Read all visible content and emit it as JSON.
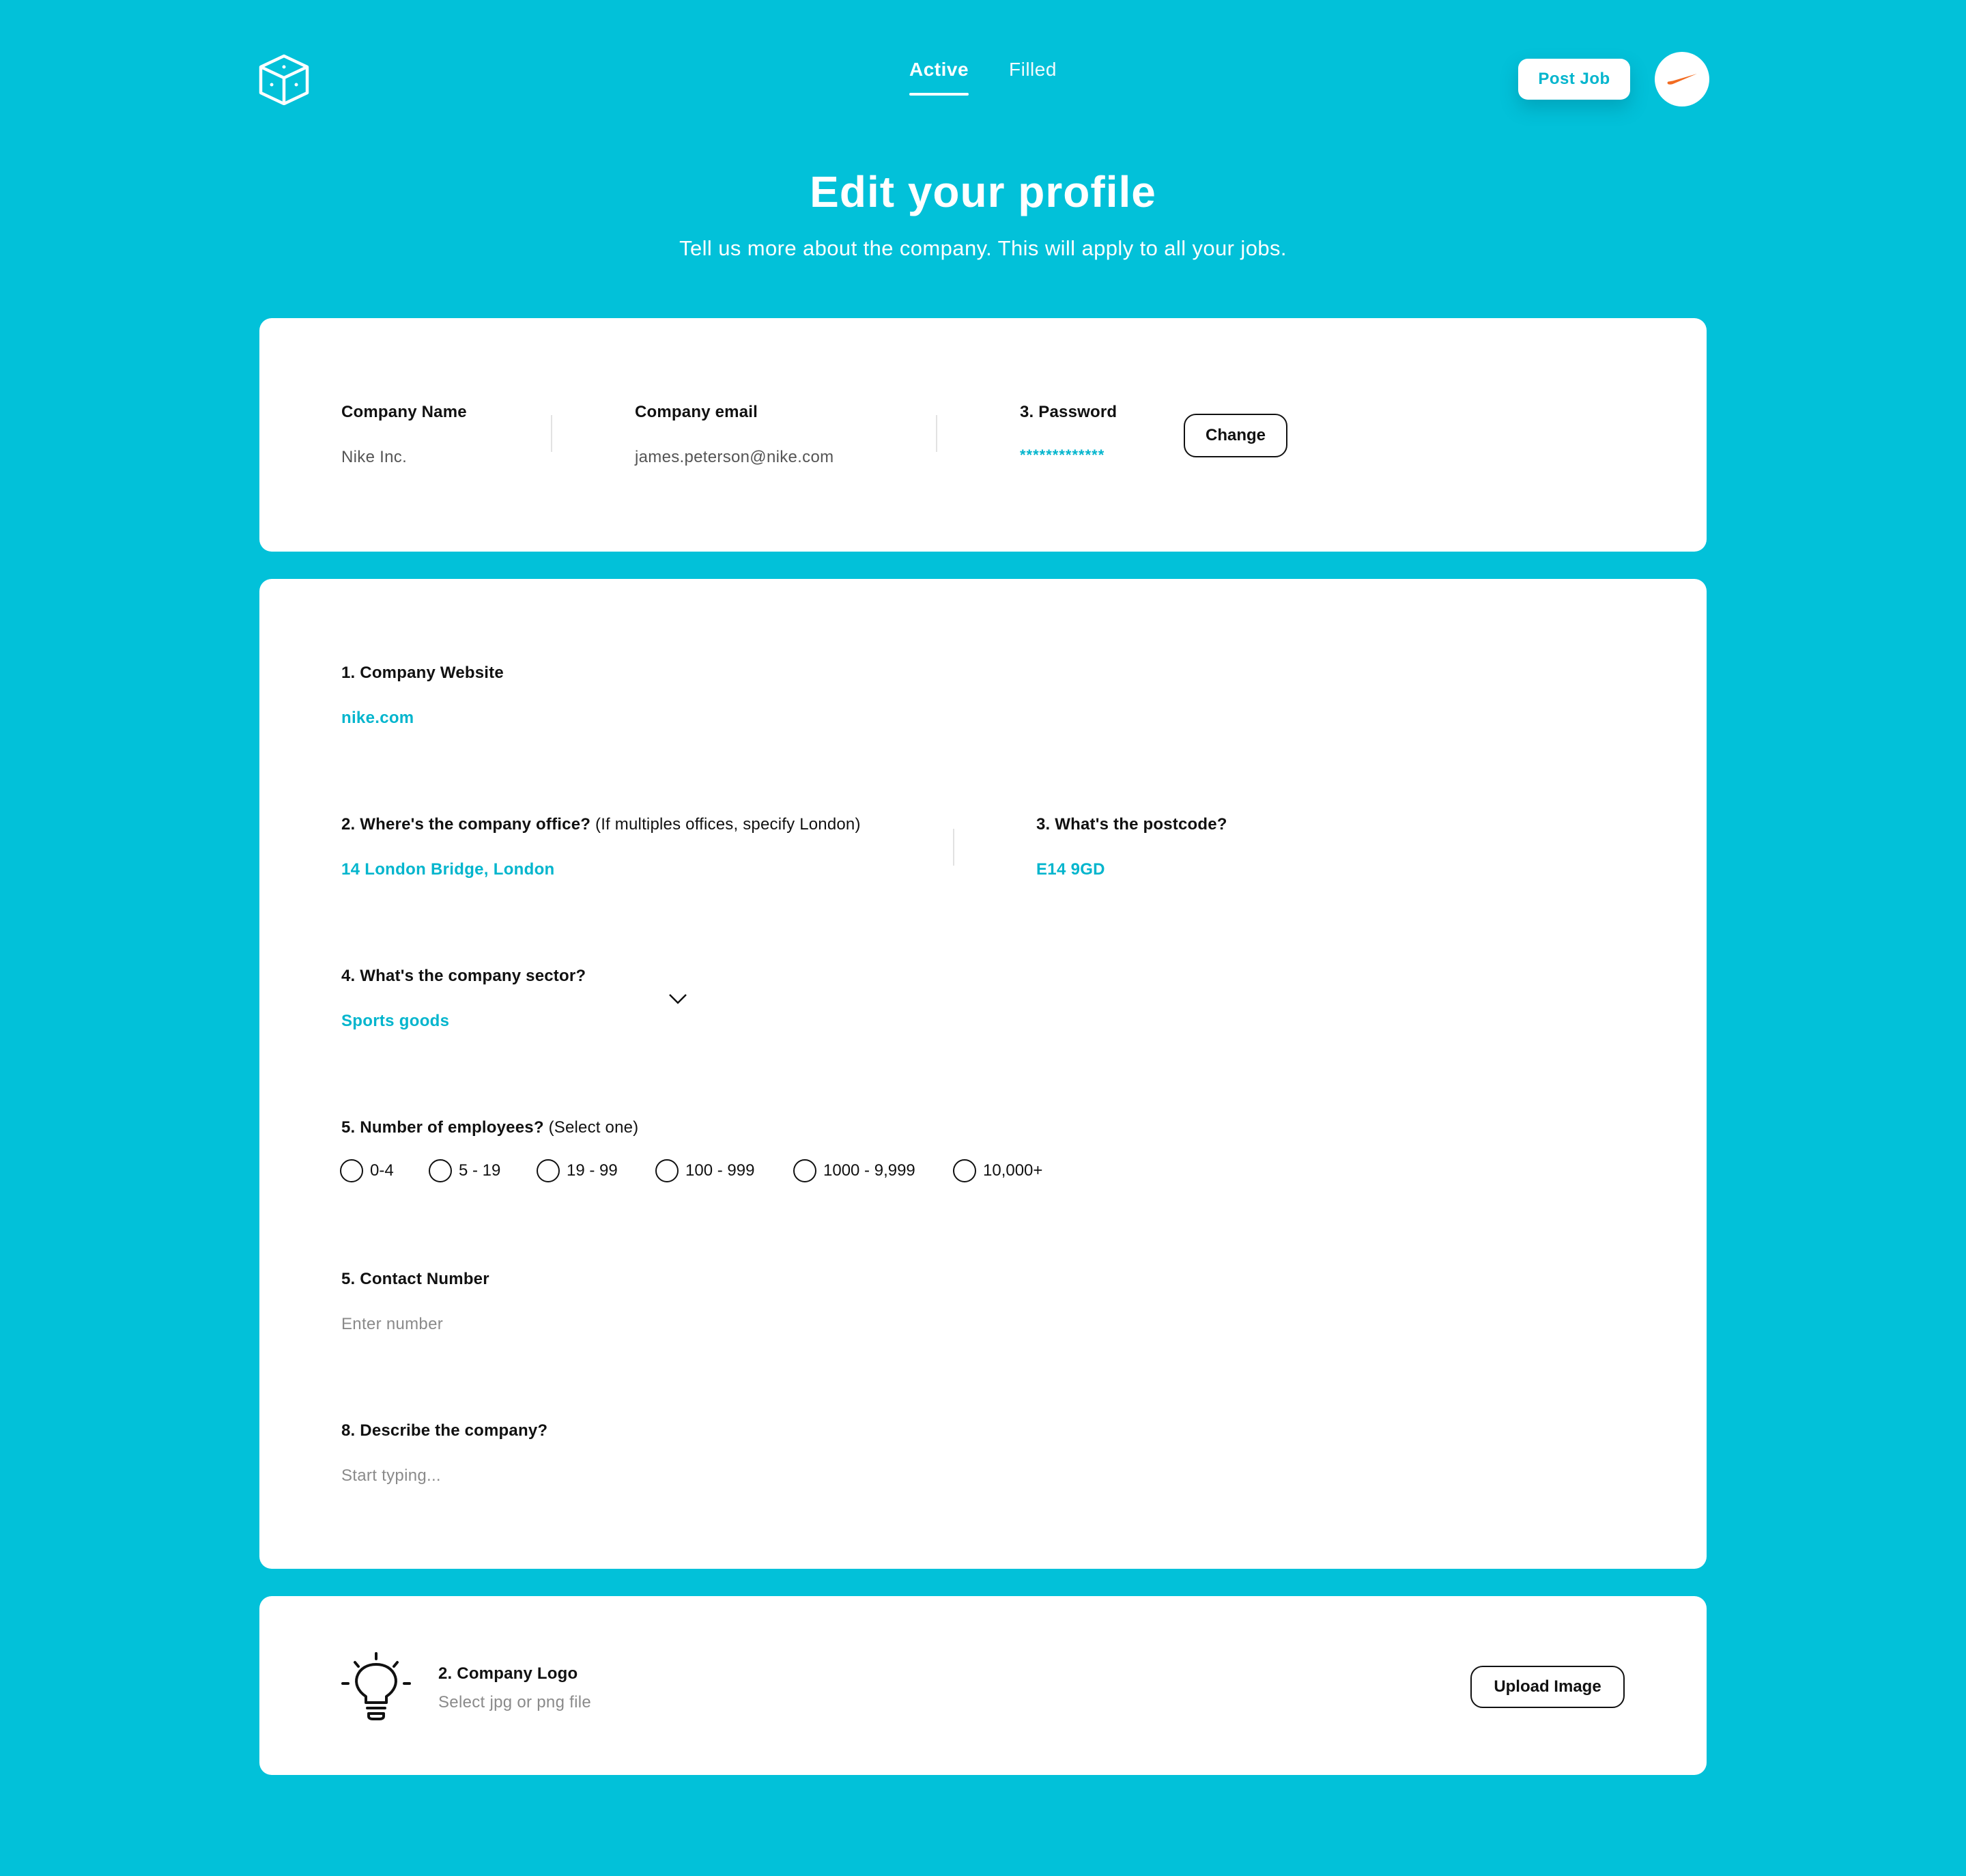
{
  "header": {
    "logo_icon": "cube-logo-icon",
    "tabs": [
      {
        "label": "Active",
        "active": true
      },
      {
        "label": "Filled",
        "active": false
      }
    ],
    "post_job_label": "Post Job",
    "avatar_icon": "nike-swoosh-icon"
  },
  "hero": {
    "title": "Edit your profile",
    "subtitle": "Tell us more about the company. This will apply to all your jobs."
  },
  "account": {
    "company_name_label": "Company Name",
    "company_name_value": "Nike Inc.",
    "company_email_label": "Company email",
    "company_email_value": "james.peterson@nike.com",
    "password_label": "3. Password",
    "password_value": "*************",
    "change_label": "Change"
  },
  "details": {
    "website_label": "1. Company Website",
    "website_value": "nike.com",
    "office_label": "2. Where's the company office?",
    "office_hint": "(If multiples offices, specify London)",
    "office_value": "14 London Bridge, London",
    "postcode_label": "3. What's the postcode?",
    "postcode_value": "E14 9GD",
    "sector_label": "4. What's the company sector?",
    "sector_value": "Sports goods",
    "employees_label": "5. Number of employees?",
    "employees_hint": "(Select one)",
    "employee_options": [
      "0-4",
      "5 - 19",
      "19 - 99",
      "100 - 999",
      "1000 - 9,999",
      "10,000+"
    ],
    "contact_label": "5. Contact Number",
    "contact_placeholder": "Enter number",
    "describe_label": "8. Describe the company?",
    "describe_placeholder": "Start typing..."
  },
  "logo_upload": {
    "icon": "lightbulb-icon",
    "label": "2. Company Logo",
    "hint": "Select jpg or png file",
    "button_label": "Upload Image"
  },
  "colors": {
    "background": "#02c1d9",
    "accent": "#02b5cd",
    "nike_orange": "#f26b21"
  }
}
